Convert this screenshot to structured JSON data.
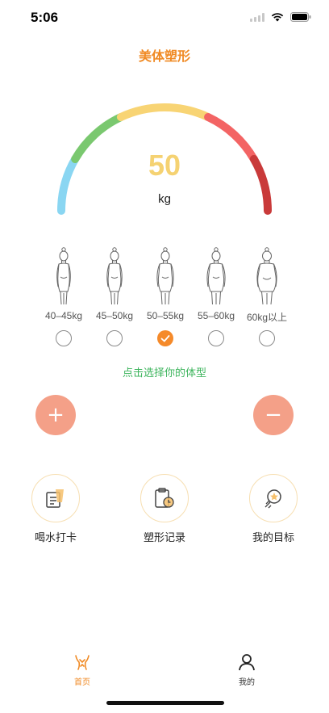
{
  "status_bar": {
    "time": "5:06"
  },
  "title": "美体塑形",
  "gauge": {
    "value": "50",
    "unit": "kg",
    "colors": [
      "#8ad6f2",
      "#7ac86f",
      "#f8d474",
      "#f36464",
      "#c93a3a"
    ]
  },
  "body_types": [
    {
      "range": "40–45kg",
      "selected": false
    },
    {
      "range": "45–50kg",
      "selected": false
    },
    {
      "range": "50–55kg",
      "selected": true
    },
    {
      "range": "55–60kg",
      "selected": false
    },
    {
      "range": "60kg以上",
      "selected": false
    }
  ],
  "hint": "点击选择你的体型",
  "buttons": {
    "plus": "+",
    "minus": "−"
  },
  "shortcuts": [
    {
      "label": "喝水打卡",
      "icon": "water-checkin-icon"
    },
    {
      "label": "塑形记录",
      "icon": "clipboard-clock-icon"
    },
    {
      "label": "我的目标",
      "icon": "target-star-icon"
    }
  ],
  "tabs": [
    {
      "label": "首页",
      "icon": "home-body-icon",
      "active": true
    },
    {
      "label": "我的",
      "icon": "person-icon",
      "active": false
    }
  ],
  "colors": {
    "accent": "#f58a2a",
    "hint": "#3cb45c",
    "button": "#f4a088"
  }
}
